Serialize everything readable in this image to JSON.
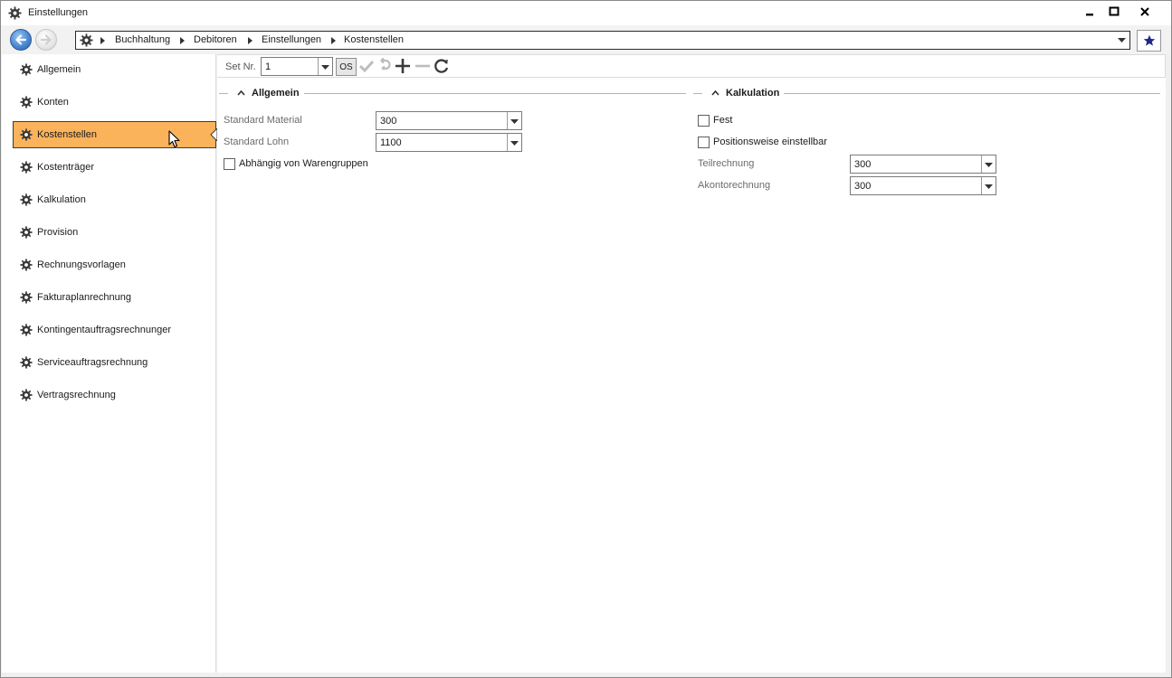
{
  "window": {
    "title": "Einstellungen",
    "icon": "gear-icon"
  },
  "breadcrumb": [
    "Buchhaltung",
    "Debitoren",
    "Einstellungen",
    "Kostenstellen"
  ],
  "sidebar": {
    "items": [
      {
        "label": "Allgemein"
      },
      {
        "label": "Konten"
      },
      {
        "label": "Kostenstellen",
        "active": true
      },
      {
        "label": "Kostenträger"
      },
      {
        "label": "Kalkulation"
      },
      {
        "label": "Provision"
      },
      {
        "label": "Rechnungsvorlagen"
      },
      {
        "label": "Fakturaplanrechnung"
      },
      {
        "label": "Kontingentauftragsrechnunger"
      },
      {
        "label": "Serviceauftragsrechnung"
      },
      {
        "label": "Vertragsrechnung"
      }
    ],
    "active_color": "#fbb35b"
  },
  "toolbar": {
    "set_label": "Set Nr.",
    "set_value": "1",
    "os_label": "OS"
  },
  "allgemein": {
    "title": "Allgemein",
    "standard_material_label": "Standard Material",
    "standard_material_value": "300",
    "standard_lohn_label": "Standard Lohn",
    "standard_lohn_value": "1100",
    "warengruppen_label": "Abhängig von Warengruppen"
  },
  "kalkulation": {
    "title": "Kalkulation",
    "fest_label": "Fest",
    "positionsweise_label": "Positionsweise einstellbar",
    "teilrechnung_label": "Teilrechnung",
    "teilrechnung_value": "300",
    "akontorechnung_label": "Akontorechnung",
    "akontorechnung_value": "300"
  }
}
